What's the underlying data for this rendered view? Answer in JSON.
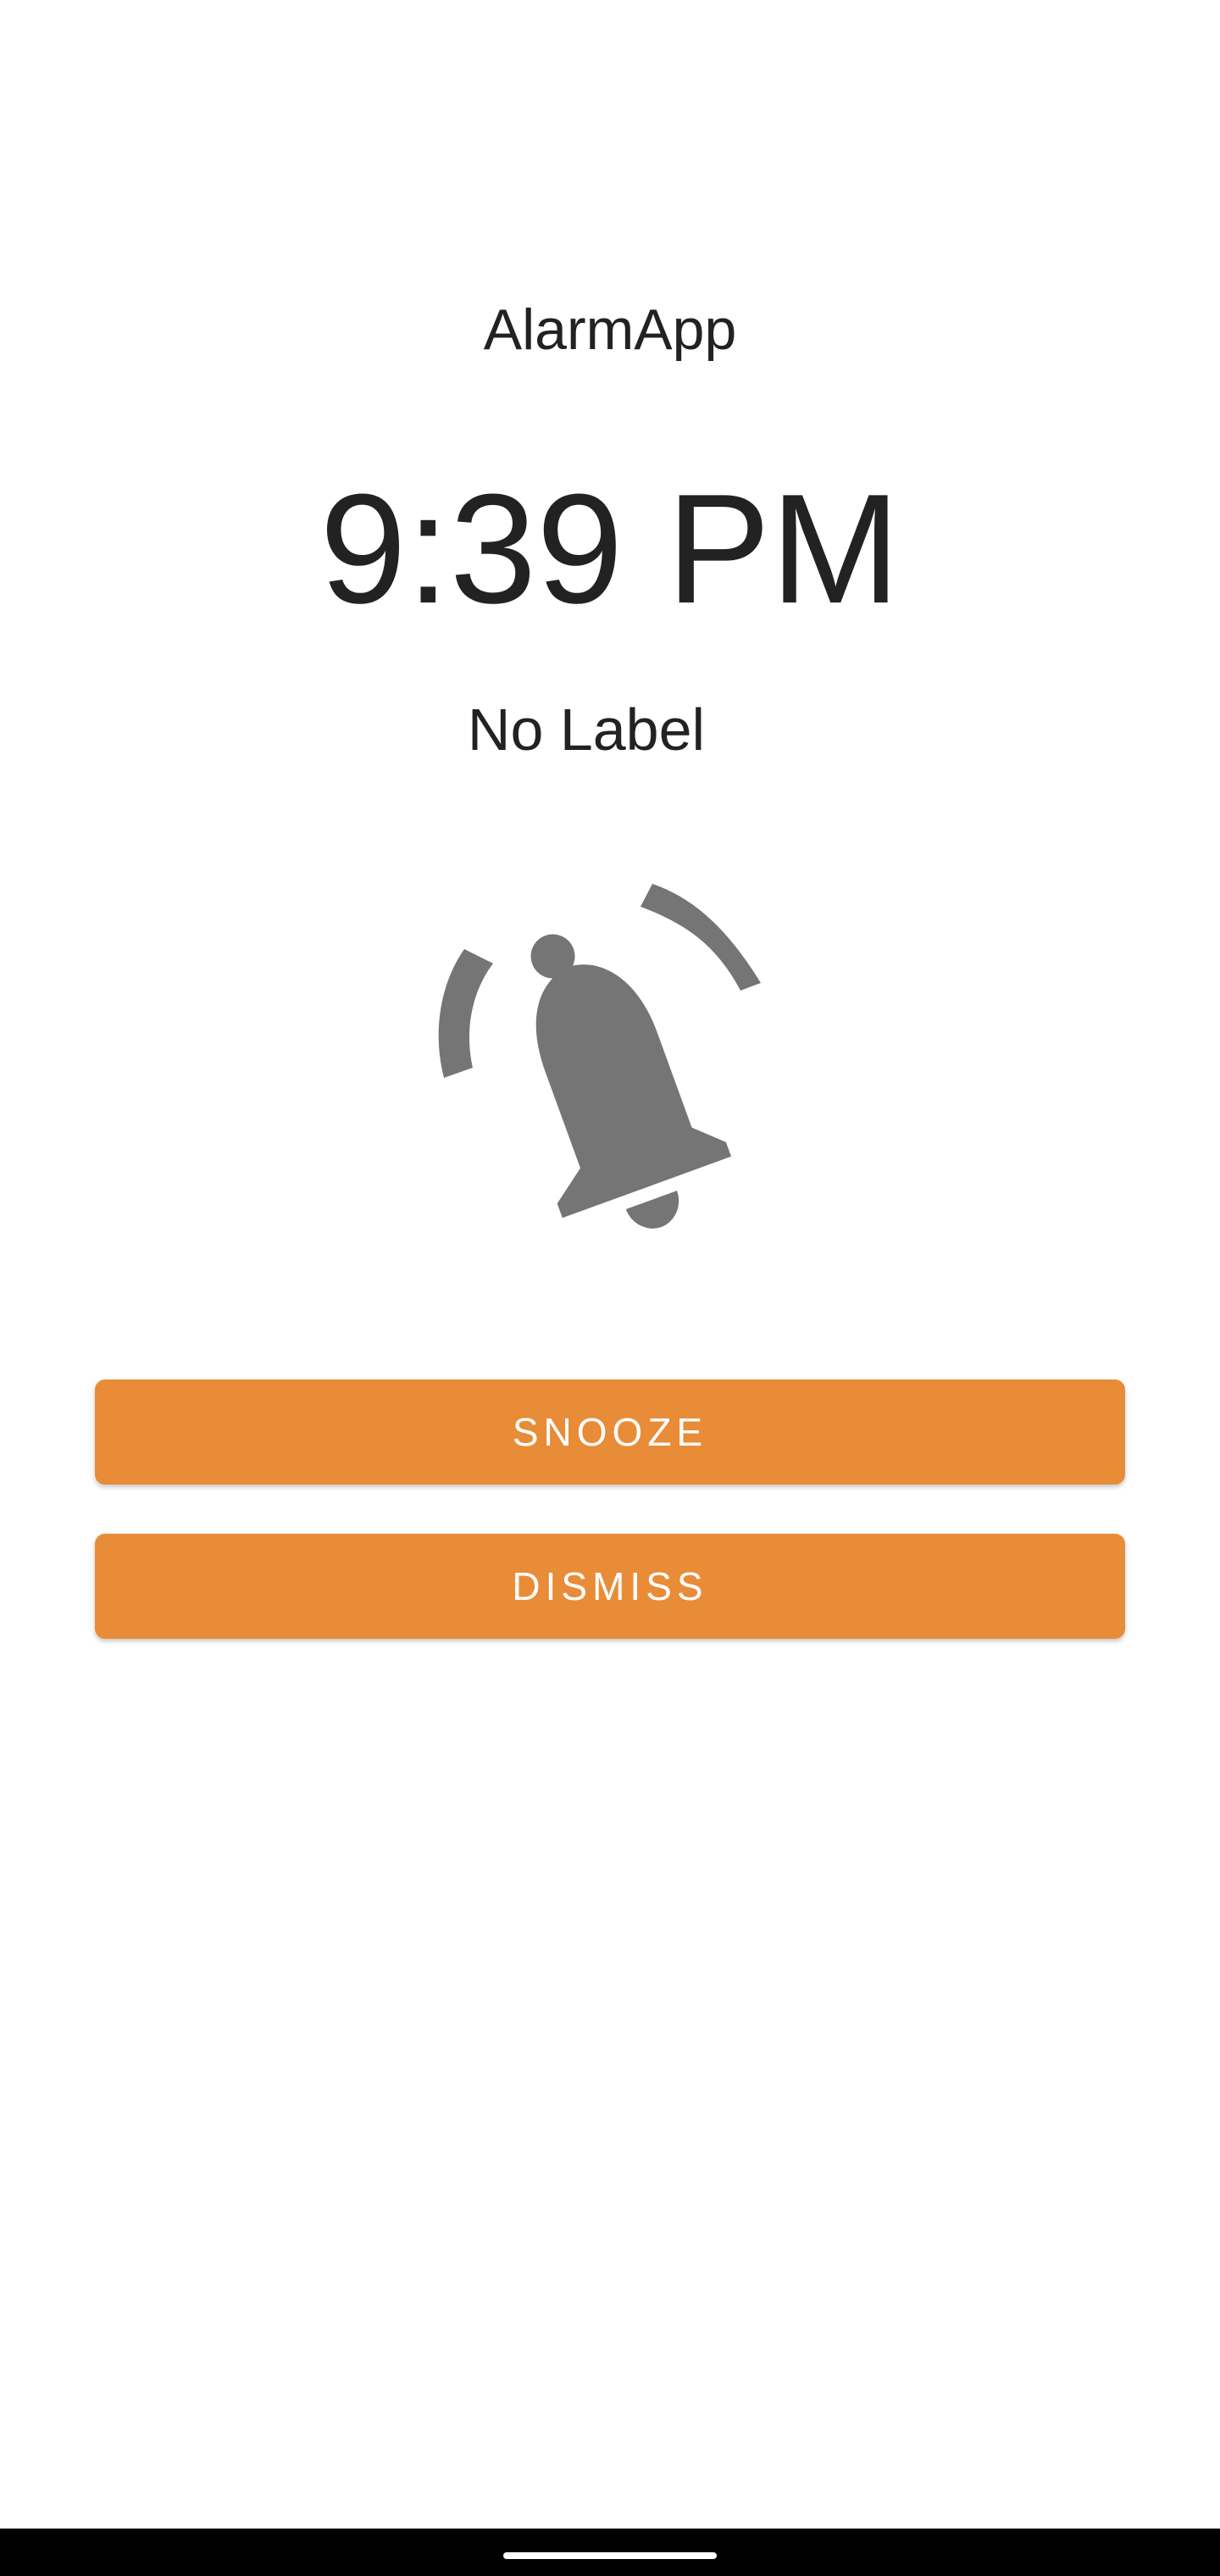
{
  "app": {
    "title": "AlarmApp"
  },
  "alarm": {
    "time": "9:39 PM",
    "label": "No Label"
  },
  "icon": {
    "name": "alarm-ringing-bell-icon",
    "color": "#757575"
  },
  "actions": {
    "snooze_label": "SNOOZE",
    "dismiss_label": "DISMISS",
    "button_color": "#e98c37"
  },
  "system": {
    "nav_bar_color": "#000000"
  }
}
